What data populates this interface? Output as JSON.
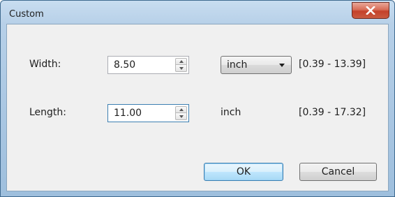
{
  "window": {
    "title": "Custom",
    "close_icon": "close-icon",
    "close_color": "#c4412a"
  },
  "width": {
    "label": "Width:",
    "value": "8.50",
    "unit_selected": "inch",
    "range": "[0.39 - 13.39]"
  },
  "length": {
    "label": "Length:",
    "value": "11.00",
    "unit": "inch",
    "range": "[0.39 - 17.32]"
  },
  "buttons": {
    "ok": "OK",
    "cancel": "Cancel"
  }
}
